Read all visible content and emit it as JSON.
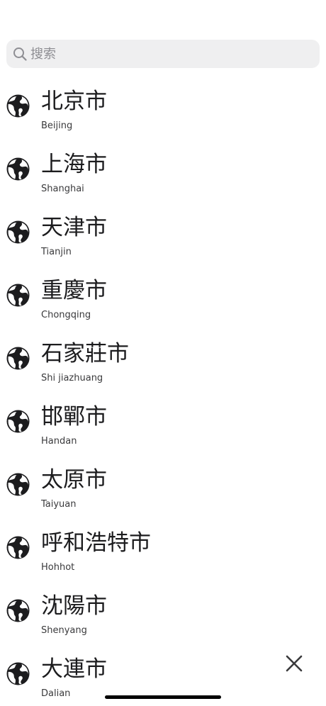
{
  "search": {
    "placeholder": "搜索",
    "value": ""
  },
  "cities": [
    {
      "name": "北京市",
      "romanized": "Beijing",
      "icon": "globe-icon"
    },
    {
      "name": "上海市",
      "romanized": "Shanghai",
      "icon": "globe-icon"
    },
    {
      "name": "天津市",
      "romanized": "Tianjin",
      "icon": "globe-icon"
    },
    {
      "name": "重慶市",
      "romanized": "Chongqing",
      "icon": "globe-icon"
    },
    {
      "name": "石家莊市",
      "romanized": "Shi jiazhuang",
      "icon": "globe-icon"
    },
    {
      "name": "邯鄲市",
      "romanized": "Handan",
      "icon": "globe-icon"
    },
    {
      "name": "太原市",
      "romanized": "Taiyuan",
      "icon": "globe-icon"
    },
    {
      "name": "呼和浩特市",
      "romanized": "Hohhot",
      "icon": "globe-icon"
    },
    {
      "name": "沈陽市",
      "romanized": "Shenyang",
      "icon": "globe-icon"
    },
    {
      "name": "大連市",
      "romanized": "Dalian",
      "icon": "globe-icon"
    }
  ],
  "controls": {
    "close_icon": "close-icon"
  },
  "colors": {
    "search_background": "#efeff0",
    "text_primary": "#1c1c1e",
    "text_secondary": "#3a3a3c",
    "placeholder": "#8e8e93",
    "icon": "#1c1c1e"
  }
}
